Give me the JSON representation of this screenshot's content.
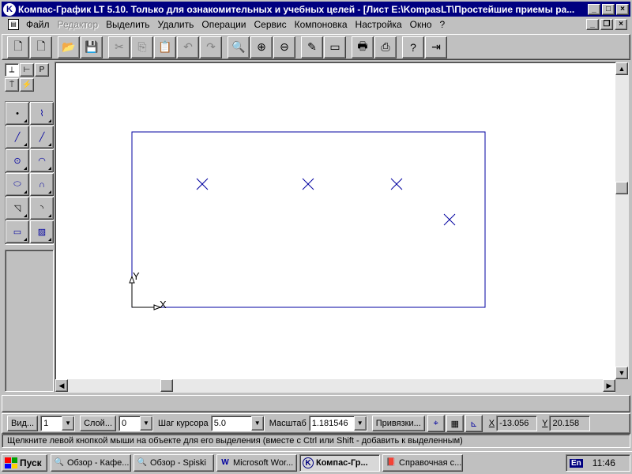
{
  "window": {
    "title": "Компас-График LT 5.10. Только для ознакомительных и учебных целей - [Лист E:\\KompasLT\\Простейшие приемы ра...",
    "app_icon_glyph": "K",
    "controls": {
      "minimize": "_",
      "maximize": "□",
      "close": "×"
    }
  },
  "menu": {
    "items": [
      {
        "label": "Файл",
        "disabled": false
      },
      {
        "label": "Редактор",
        "disabled": true
      },
      {
        "label": "Выделить",
        "disabled": false
      },
      {
        "label": "Удалить",
        "disabled": false
      },
      {
        "label": "Операции",
        "disabled": false
      },
      {
        "label": "Сервис",
        "disabled": false
      },
      {
        "label": "Компоновка",
        "disabled": false
      },
      {
        "label": "Настройка",
        "disabled": false
      },
      {
        "label": "Окно",
        "disabled": false
      },
      {
        "label": "?",
        "disabled": false
      }
    ],
    "mdi_controls": {
      "minimize": "_",
      "restore": "❐",
      "close": "×"
    }
  },
  "toolbar": {
    "buttons": [
      {
        "icon": "new-sheet-icon",
        "glyph": "🗋"
      },
      {
        "icon": "new-fragment-icon",
        "glyph": "🗋"
      },
      {
        "icon": "open-icon",
        "glyph": "📂"
      },
      {
        "icon": "save-icon",
        "glyph": "💾"
      },
      {
        "icon": "cut-icon",
        "glyph": "✂",
        "disabled": true
      },
      {
        "icon": "copy-icon",
        "glyph": "⎘",
        "disabled": true
      },
      {
        "icon": "paste-icon",
        "glyph": "📋",
        "disabled": true
      },
      {
        "icon": "undo-icon",
        "glyph": "↶",
        "disabled": true
      },
      {
        "icon": "redo-icon",
        "glyph": "↷",
        "disabled": true
      },
      {
        "icon": "zoom-icon",
        "glyph": "🔍"
      },
      {
        "icon": "zoom-in-icon",
        "glyph": "⊕"
      },
      {
        "icon": "zoom-out-icon",
        "glyph": "⊖"
      },
      {
        "icon": "regenerate-icon",
        "glyph": "✎"
      },
      {
        "icon": "show-all-icon",
        "glyph": "▭"
      },
      {
        "icon": "print-preview-icon",
        "glyph": "🖶"
      },
      {
        "icon": "print-icon",
        "glyph": "⎙"
      },
      {
        "icon": "help-pointer-icon",
        "glyph": "?"
      },
      {
        "icon": "exit-icon",
        "glyph": "⇥"
      }
    ]
  },
  "left_panel": {
    "mode_tabs": [
      {
        "icon": "geometry-mode-icon",
        "glyph": "⟂"
      },
      {
        "icon": "dimensions-mode-icon",
        "glyph": "⊢"
      },
      {
        "icon": "text-mode-icon",
        "glyph": "Р"
      },
      {
        "icon": "symbols-mode-icon",
        "glyph": "⍑"
      },
      {
        "icon": "measure-mode-icon",
        "glyph": "⚡"
      }
    ],
    "tools": [
      {
        "icon": "point-tool-icon",
        "glyph": "•"
      },
      {
        "icon": "auxiliary-line-tool-icon",
        "glyph": "⌇"
      },
      {
        "icon": "segment-tool-icon",
        "glyph": "╱"
      },
      {
        "icon": "segment-tangent-tool-icon",
        "glyph": "╱"
      },
      {
        "icon": "circle-tool-icon",
        "glyph": "⊙"
      },
      {
        "icon": "arc-tool-icon",
        "glyph": "◠"
      },
      {
        "icon": "ellipse-tool-icon",
        "glyph": "⬭"
      },
      {
        "icon": "spline-tool-icon",
        "glyph": "∩"
      },
      {
        "icon": "chamfer-tool-icon",
        "glyph": "◹"
      },
      {
        "icon": "fillet-tool-icon",
        "glyph": "◝"
      },
      {
        "icon": "rectangle-tool-icon",
        "glyph": "▭"
      },
      {
        "icon": "hatch-tool-icon",
        "glyph": "▨"
      }
    ]
  },
  "drawing": {
    "axis_x_label": "X",
    "axis_y_label": "Y",
    "line_color": "#0000a0"
  },
  "property_bar": {
    "view_button": "Вид...",
    "view_value": "1",
    "layer_button": "Слой...",
    "layer_value": "0",
    "cursor_step_label": "Шаг курсора",
    "cursor_step_value": "5.0",
    "scale_label": "Масштаб",
    "scale_value": "1.181546",
    "snaps_button": "Привязки...",
    "icons": [
      "snap-settings-icon",
      "grid-icon",
      "local-cs-icon"
    ],
    "x_label": "X",
    "x_value": "-13.056",
    "y_label": "Y",
    "y_value": "20.158"
  },
  "status_bar": {
    "message": "Щелкните левой кнопкой мыши на объекте для его выделения (вместе с Ctrl или Shift - добавить к выделенным)"
  },
  "taskbar": {
    "start_label": "Пуск",
    "tasks": [
      {
        "label": "Обзор - Кафе...",
        "icon": "explorer-icon",
        "glyph": "🔍",
        "active": false
      },
      {
        "label": "Обзор - Spiski",
        "icon": "explorer-icon",
        "glyph": "🔍",
        "active": false
      },
      {
        "label": "Microsoft Wor...",
        "icon": "word-icon",
        "glyph": "W",
        "active": false
      },
      {
        "label": "Компас-Гр...",
        "icon": "kompas-icon",
        "glyph": "K",
        "active": true
      },
      {
        "label": "Справочная с...",
        "icon": "help-book-icon",
        "glyph": "📕",
        "active": false
      }
    ],
    "lang": "En",
    "clock": "11:46"
  }
}
